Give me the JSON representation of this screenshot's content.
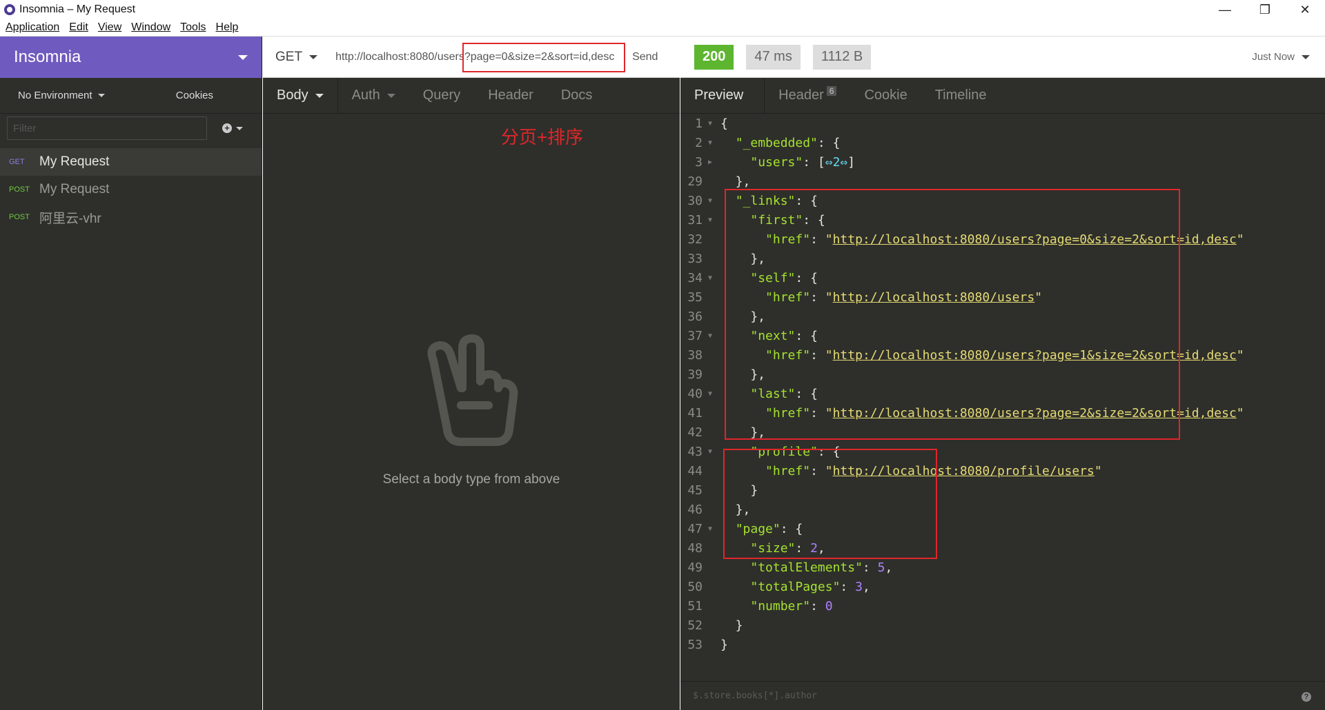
{
  "window": {
    "title": "Insomnia – My Request",
    "controls": [
      "—",
      "❐",
      "✕"
    ]
  },
  "menu": [
    "Application",
    "Edit",
    "View",
    "Window",
    "Tools",
    "Help"
  ],
  "sidebar": {
    "app_name": "Insomnia",
    "environment": "No Environment",
    "cookies": "Cookies",
    "filter_placeholder": "Filter",
    "requests": [
      {
        "method": "GET",
        "name": "My Request",
        "active": true
      },
      {
        "method": "POST",
        "name": "My Request",
        "active": false
      },
      {
        "method": "POST",
        "name": "阿里云-vhr",
        "active": false
      }
    ]
  },
  "request": {
    "method": "GET",
    "url": "http://localhost:8080/users?page=0&size=2&sort=id,desc",
    "send_label": "Send",
    "tabs": [
      "Body",
      "Auth",
      "Query",
      "Header",
      "Docs"
    ],
    "annotation": "分页+排序",
    "empty_body_text": "Select a body type from above"
  },
  "response": {
    "status": "200",
    "time": "47 ms",
    "size": "1112 B",
    "timestamp": "Just Now",
    "tabs": [
      "Preview",
      "Header",
      "Cookie",
      "Timeline"
    ],
    "header_count": "6",
    "jsonpath_placeholder": "$.store.books[*].author",
    "collapsed_count": "2",
    "links": {
      "first": "http://localhost:8080/users?page=0&size=2&sort=id,desc",
      "self": "http://localhost:8080/users",
      "next": "http://localhost:8080/users?page=1&size=2&sort=id,desc",
      "last": "http://localhost:8080/users?page=2&size=2&sort=id,desc",
      "profile": "http://localhost:8080/profile/users"
    },
    "page": {
      "size": "2",
      "totalElements": "5",
      "totalPages": "3",
      "number": "0"
    },
    "line_numbers": [
      "1",
      "2",
      "3",
      "29",
      "30",
      "31",
      "32",
      "33",
      "34",
      "35",
      "36",
      "37",
      "38",
      "39",
      "40",
      "41",
      "42",
      "43",
      "44",
      "45",
      "46",
      "47",
      "48",
      "49",
      "50",
      "51",
      "52",
      "53"
    ]
  },
  "colors": {
    "accent": "#6f5bbf",
    "status_ok": "#5db530",
    "highlight": "#e0262a",
    "json_key": "#a6e22e",
    "json_string": "#e6db74",
    "json_number": "#ae81ff"
  },
  "icons": {
    "app": "insomnia-logo-icon",
    "empty_body": "peace-hand-icon",
    "add": "plus-circle-icon",
    "help": "help-icon"
  }
}
